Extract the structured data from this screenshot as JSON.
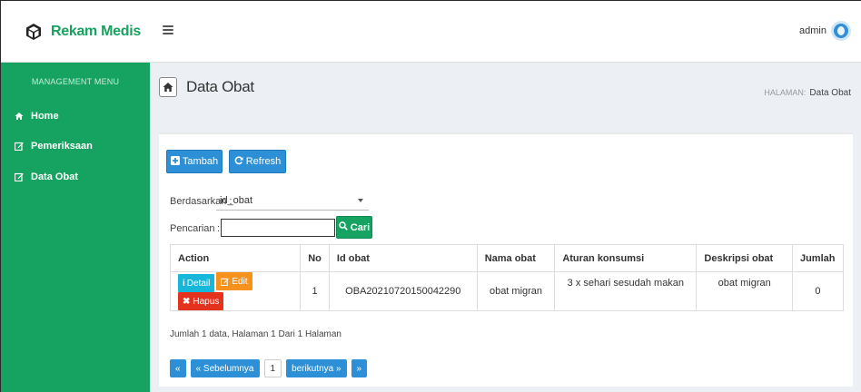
{
  "brand": {
    "name": "Rekam Medis"
  },
  "user": {
    "name": "admin"
  },
  "sidebar": {
    "title": "MANAGEMENT MENU",
    "items": [
      {
        "label": "Home",
        "icon": "home-icon"
      },
      {
        "label": "Pemeriksaan",
        "icon": "edit-icon"
      },
      {
        "label": "Data Obat",
        "icon": "edit-icon"
      }
    ]
  },
  "page": {
    "title": "Data Obat",
    "breadcrumb_label": "HALAMAN:",
    "breadcrumb_current": "Data Obat"
  },
  "toolbar": {
    "tambah_label": "Tambah",
    "refresh_label": "Refresh"
  },
  "filter": {
    "by_label": "Berdasarkan :",
    "by_value": "id_obat",
    "search_label": "Pencarian",
    "search_sep": ":",
    "search_value": "",
    "search_button": "Cari"
  },
  "table": {
    "columns": [
      "Action",
      "No",
      "Id obat",
      "Nama obat",
      "Aturan konsumsi",
      "Deskripsi obat",
      "Jumlah"
    ],
    "actions": {
      "detail": "Detail",
      "edit": "Edit",
      "hapus": "Hapus"
    },
    "rows": [
      {
        "no": "1",
        "id_obat": "OBA20210720150042290",
        "nama_obat": "obat migran",
        "aturan": "3 x sehari sesudah makan",
        "deskripsi": "obat migran",
        "jumlah": "0"
      }
    ]
  },
  "summary": "Jumlah 1 data, Halaman 1 Dari 1 Halaman",
  "pagination": {
    "first": "«",
    "prev": "« Sebelumnya",
    "current": "1",
    "next": "berikutnya »",
    "last": "»"
  },
  "colors": {
    "brand_green": "#16a361",
    "primary_blue": "#2d8fd5",
    "danger_red": "#e5321f",
    "warning_orange": "#f5921e",
    "info_cyan": "#16b7d8"
  }
}
